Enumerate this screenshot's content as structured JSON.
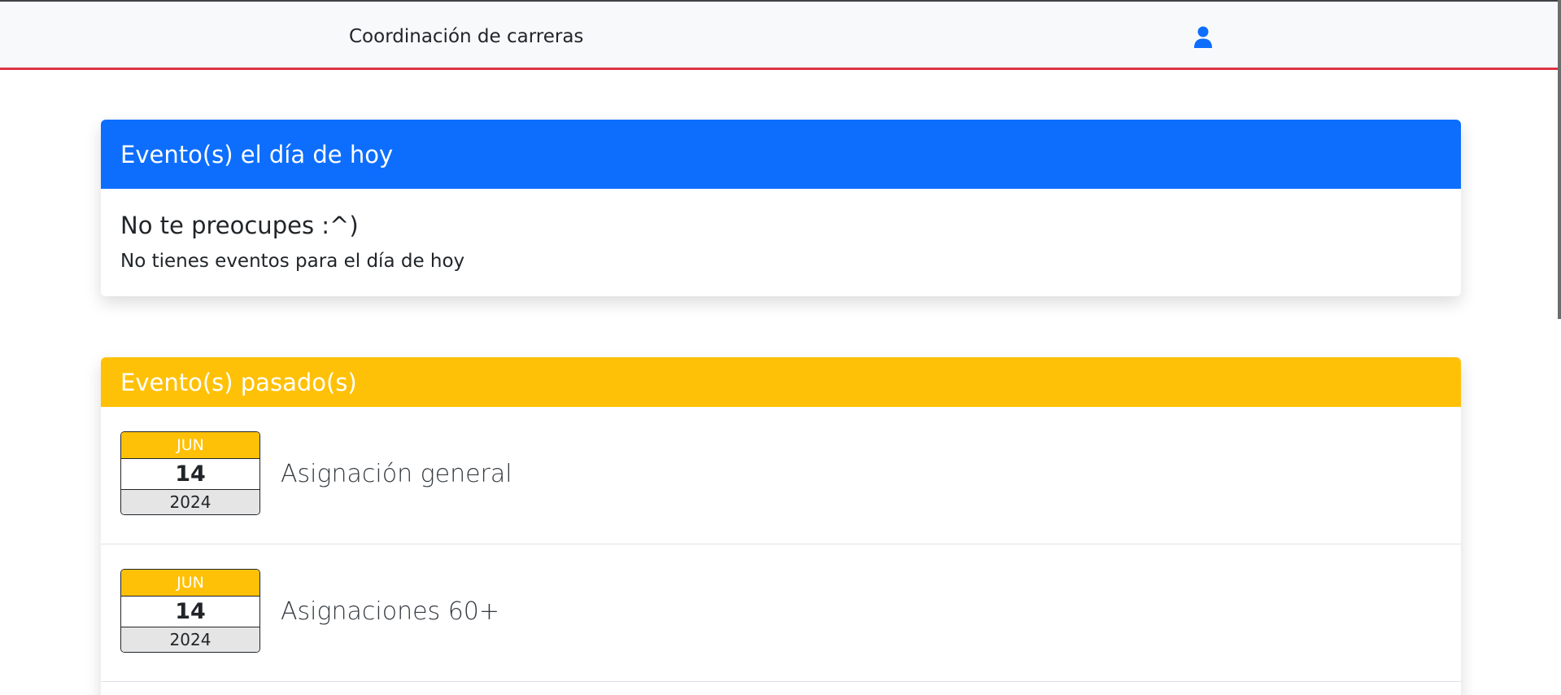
{
  "navbar": {
    "title": "Coordinación de carreras",
    "user_icon": "user-icon",
    "accent_color": "#dc3545",
    "icon_color": "#0d6efd"
  },
  "today_card": {
    "header": "Evento(s) el día de hoy",
    "heading": "No te preocupes :^)",
    "text": "No tienes eventos para el día de hoy",
    "header_color": "#0d6efd"
  },
  "past_card": {
    "header": "Evento(s) pasado(s)",
    "header_color": "#ffc107",
    "events": [
      {
        "month": "JUN",
        "day": "14",
        "year": "2024",
        "title": "Asignación general"
      },
      {
        "month": "JUN",
        "day": "14",
        "year": "2024",
        "title": "Asignaciones 60+"
      }
    ]
  }
}
